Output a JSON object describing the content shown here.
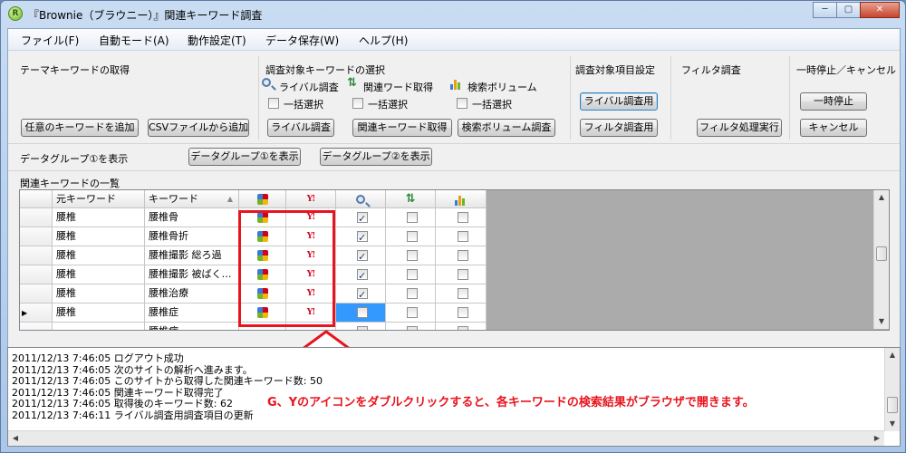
{
  "window": {
    "title": "『Brownie（ブラウニー）』関連キーワード調査",
    "app_icon_letter": "R",
    "controls": {
      "minimize": "─",
      "maximize": "▢",
      "close": "✕"
    }
  },
  "menu": [
    "ファイル(F)",
    "自動モード(A)",
    "動作設定(T)",
    "データ保存(W)",
    "ヘルプ(H)"
  ],
  "toolbar": {
    "theme": {
      "title": "テーマキーワードの取得",
      "buttons": [
        "任意のキーワードを追加",
        "CSVファイルから追加"
      ]
    },
    "target": {
      "title": "調査対象キーワードの選択",
      "checks": [
        {
          "icon": "search-icon",
          "label": "ライバル調査",
          "bulk": "一括選択",
          "button": "ライバル調査"
        },
        {
          "icon": "related-words-icon",
          "label": "関連ワード取得",
          "bulk": "一括選択",
          "button": "関連キーワード取得"
        },
        {
          "icon": "volume-chart-icon",
          "label": "検索ボリューム",
          "bulk": "一括選択",
          "button": "検索ボリューム調査"
        }
      ]
    },
    "settings": {
      "title": "調査対象項目設定",
      "buttons": [
        "ライバル調査用",
        "フィルタ調査用"
      ]
    },
    "filter": {
      "title": "フィルタ調査",
      "button": "フィルタ処理実行"
    },
    "pause": {
      "title": "一時停止／キャンセル",
      "buttons": [
        "一時停止",
        "キャンセル"
      ]
    }
  },
  "datagroup": {
    "label": "データグループ①を表示",
    "buttons": [
      "データグループ①を表示",
      "データグループ②を表示"
    ]
  },
  "grid": {
    "caption": "関連キーワードの一覧",
    "columns": [
      "元キーワード",
      "キーワード"
    ],
    "sort_indicator": "▲",
    "rows": [
      {
        "source": "腰椎",
        "keyword": "腰椎骨",
        "rival": true,
        "related": false,
        "volume": false,
        "current": false
      },
      {
        "source": "腰椎",
        "keyword": "腰椎骨折",
        "rival": true,
        "related": false,
        "volume": false,
        "current": false
      },
      {
        "source": "腰椎",
        "keyword": "腰椎撮影 総ろ過",
        "rival": true,
        "related": false,
        "volume": false,
        "current": false
      },
      {
        "source": "腰椎",
        "keyword": "腰椎撮影 被ばく…",
        "rival": true,
        "related": false,
        "volume": false,
        "current": false
      },
      {
        "source": "腰椎",
        "keyword": "腰椎治療",
        "rival": true,
        "related": false,
        "volume": false,
        "current": false
      },
      {
        "source": "腰椎",
        "keyword": "腰椎症",
        "rival": false,
        "related": false,
        "volume": false,
        "current": true
      },
      {
        "source": "",
        "keyword": "腰椎病",
        "rival": false,
        "related": false,
        "volume": false,
        "current": false
      }
    ],
    "row_pointer": "▶"
  },
  "log": [
    "2011/12/13 7:46:05 ログアウト成功",
    "2011/12/13 7:46:05 次のサイトの解析へ進みます。",
    "2011/12/13 7:46:05 このサイトから取得した関連キーワード数: 50",
    "2011/12/13 7:46:05 関連キーワード取得完了",
    "2011/12/13 7:46:05 取得後のキーワード数: 62",
    "2011/12/13 7:46:11 ライバル調査用調査項目の更新"
  ],
  "annotation": "G、Yのアイコンをダブルクリックすると、各キーワードの検索結果がブラウザで開きます。",
  "colors": {
    "highlight": "#e8141e",
    "selection": "#3399ff",
    "yahoo_red": "#d0021b"
  }
}
